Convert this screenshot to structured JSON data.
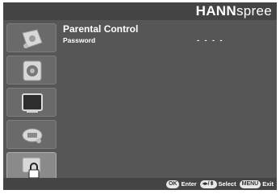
{
  "brand": {
    "bold": "HANN",
    "light": "spree"
  },
  "sidebar": {
    "items": [
      {
        "icon": "picture-icon"
      },
      {
        "icon": "audio-icon"
      },
      {
        "icon": "screen-icon"
      },
      {
        "icon": "setup-icon"
      },
      {
        "icon": "parental-lock-icon",
        "active": true
      }
    ]
  },
  "content": {
    "title": "Parental Control",
    "password_label": "Password",
    "password_value": "- - - -"
  },
  "footer": {
    "ok_key": "OK",
    "enter_label": "Enter",
    "nav_key": "◂▸/⬍",
    "select_label": "Select",
    "menu_key": "MENU",
    "exit_label": "Exit"
  },
  "colors": {
    "panel": "#565656",
    "bars": "#444444",
    "text": "#ffffff"
  }
}
